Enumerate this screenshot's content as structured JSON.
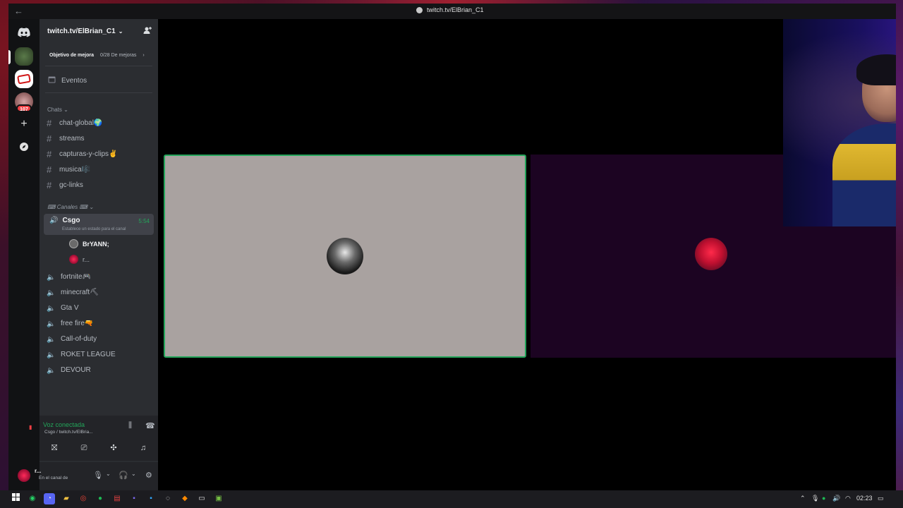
{
  "window": {
    "title": "twitch.tv/ElBrian_C1"
  },
  "server": {
    "name": "twitch.tv/ElBrian_C1"
  },
  "rail": {
    "badge_count": "107"
  },
  "boost": {
    "goal_label": "Objetivo de mejora",
    "progress": "0/28 De mejoras"
  },
  "events_label": "Eventos",
  "categories": {
    "chats": "Chats",
    "canales": "Canales"
  },
  "text_channels": [
    {
      "name": "chat-global🌍"
    },
    {
      "name": "streams"
    },
    {
      "name": "capturas-y-clips✌"
    },
    {
      "name": "musica🎼"
    },
    {
      "name": "gc-links"
    }
  ],
  "active_voice": {
    "name": "Csgo",
    "time": "5:54",
    "status": "Establece un estado para el canal"
  },
  "voice_users": [
    {
      "name": "BrYANN;"
    },
    {
      "name": "r..."
    }
  ],
  "voice_channels": [
    {
      "name": "fortnite🎮"
    },
    {
      "name": "minecraft⛏"
    },
    {
      "name": "Gta V"
    },
    {
      "name": "free fire🔫"
    },
    {
      "name": "Call-of-duty"
    },
    {
      "name": "ROKET LEAGUE"
    },
    {
      "name": "DEVOUR"
    }
  ],
  "voice_panel": {
    "connected": "Voz conectada",
    "sub": "Csgo / twitch.tv/ElBria..."
  },
  "user_panel": {
    "name": "r...",
    "status": "En el canal de"
  },
  "taskbar": {
    "time": "02:23"
  },
  "colors": {
    "accent_green": "#23a55a",
    "sidebar": "#2b2d31",
    "tile1": "#a9a2a0",
    "tile2": "#1c0422"
  }
}
